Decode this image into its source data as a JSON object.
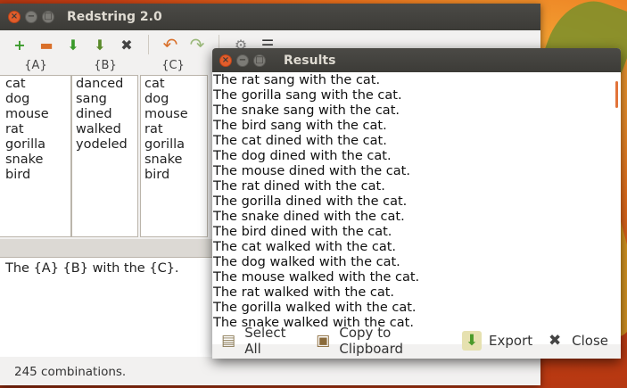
{
  "main_window": {
    "title": "Redstring 2.0",
    "toolbar": {
      "icons": [
        "new-icon",
        "open-icon",
        "save-icon",
        "export-icon",
        "delete-icon",
        "undo-icon",
        "redo-icon",
        "generate-icon",
        "menu-icon"
      ],
      "glyphs": {
        "new": "+",
        "open": "▬",
        "save": "⬇",
        "export": "⬇",
        "delete": "✖",
        "undo": "↶",
        "redo": "↷",
        "generate": "⚙",
        "menu": "☰"
      }
    },
    "columns": [
      {
        "header": "{A}",
        "items": [
          "cat",
          "dog",
          "mouse",
          "rat",
          "gorilla",
          "snake",
          "bird"
        ]
      },
      {
        "header": "{B}",
        "items": [
          "danced",
          "sang",
          "dined",
          "walked",
          "yodeled"
        ]
      },
      {
        "header": "{C}",
        "items": [
          "cat",
          "dog",
          "mouse",
          "rat",
          "gorilla",
          "snake",
          "bird"
        ]
      }
    ],
    "template": "The {A} {B} with the {C}.",
    "status": "245 combinations."
  },
  "results_window": {
    "title": "Results",
    "lines": [
      "The rat sang with the cat.",
      "The gorilla sang with the cat.",
      "The snake sang with the cat.",
      "The bird sang with the cat.",
      "The cat dined with the cat.",
      "The dog dined with the cat.",
      "The mouse dined with the cat.",
      "The rat dined with the cat.",
      "The gorilla dined with the cat.",
      "The snake dined with the cat.",
      "The bird dined with the cat.",
      "The cat walked with the cat.",
      "The dog walked with the cat.",
      "The mouse walked with the cat.",
      "The rat walked with the cat.",
      "The gorilla walked with the cat.",
      "The snake walked with the cat."
    ],
    "actions": {
      "select_all": "Select All",
      "copy": "Copy to Clipboard",
      "export": "Export",
      "close": "Close"
    },
    "action_glyphs": {
      "select_all": "▤",
      "copy": "▣",
      "export": "⬇",
      "close": "✖"
    }
  },
  "window_controls": {
    "close": "×",
    "minimize": "−",
    "maximize": "□"
  },
  "colors": {
    "accent": "#e25d2b",
    "titlebar": "#3c3b37"
  }
}
